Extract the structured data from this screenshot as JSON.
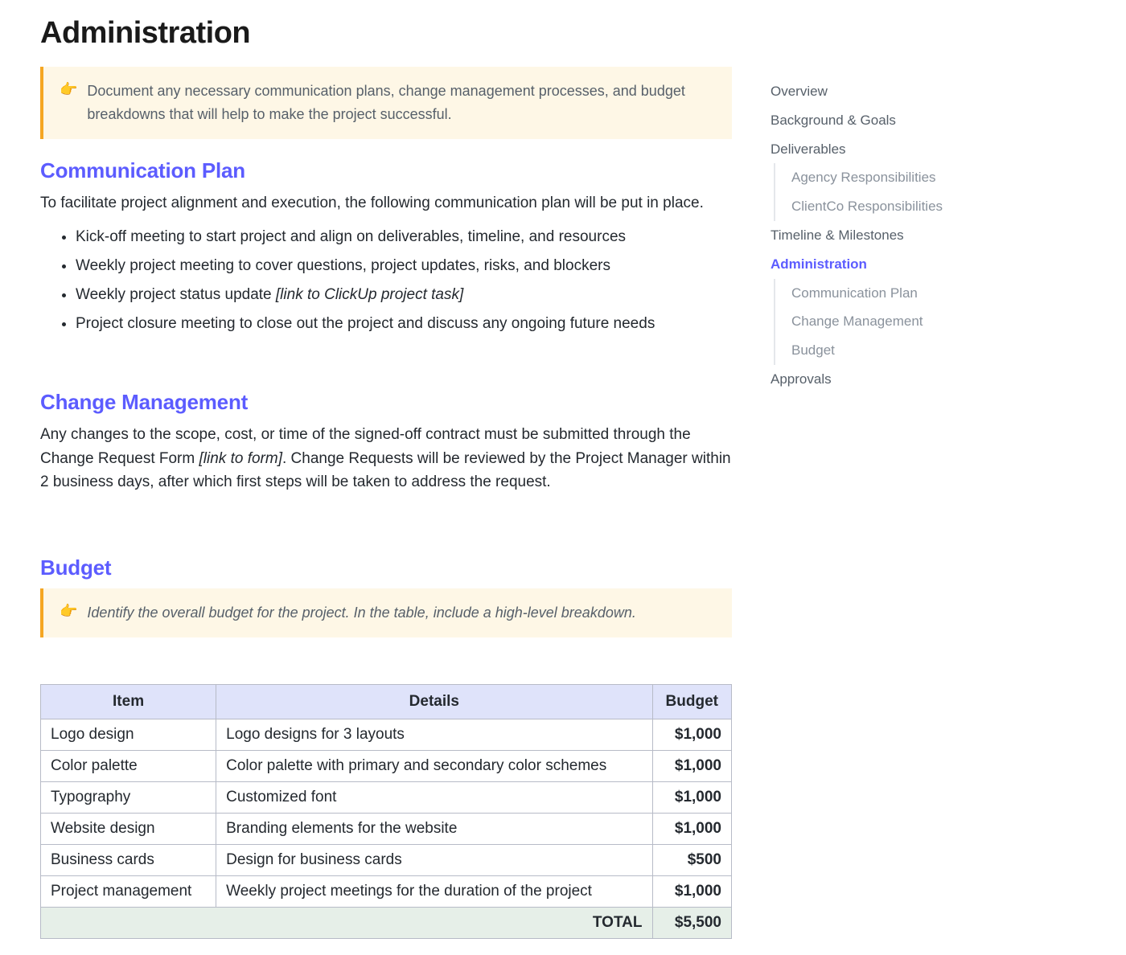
{
  "title": "Administration",
  "callout1": "Document any necessary communication plans, change management processes, and budget breakdowns that will help to make the project successful.",
  "sections": {
    "comm": {
      "heading": "Communication Plan",
      "intro": "To facilitate project alignment and execution, the following communication plan will be put in place.",
      "bullets": [
        {
          "text": "Kick-off meeting to start project and align on deliverables, timeline, and resources",
          "suffix": ""
        },
        {
          "text": "Weekly project meeting to cover questions, project updates, risks, and blockers",
          "suffix": ""
        },
        {
          "text": "Weekly project status update ",
          "suffix": "[link to ClickUp project task]"
        },
        {
          "text": "Project closure meeting to close out the project and discuss any ongoing future needs",
          "suffix": ""
        }
      ]
    },
    "change": {
      "heading": "Change Management",
      "para_pre": "Any changes to the scope, cost, or time of the signed-off contract must be submitted through the Change Request Form ",
      "para_link": "[link to form]",
      "para_post": ". Change Requests will be reviewed by the Project Manager within 2 business days, after which first steps will be taken to address the request."
    },
    "budget": {
      "heading": "Budget",
      "callout": "Identify the overall budget for the project. In the table, include a high-level breakdown.",
      "columns": [
        "Item",
        "Details",
        "Budget"
      ],
      "rows": [
        {
          "item": "Logo design",
          "details": "Logo designs for 3 layouts",
          "amount": "$1,000"
        },
        {
          "item": "Color palette",
          "details": "Color palette with primary and secondary color schemes",
          "amount": "$1,000"
        },
        {
          "item": "Typography",
          "details": "Customized font",
          "amount": "$1,000"
        },
        {
          "item": "Website design",
          "details": "Branding elements for the website",
          "amount": "$1,000"
        },
        {
          "item": "Business cards",
          "details": "Design for business cards",
          "amount": "$500"
        },
        {
          "item": "Project management",
          "details": "Weekly project meetings for the duration of the project",
          "amount": "$1,000"
        }
      ],
      "total_label": "TOTAL",
      "total_amount": "$5,500"
    }
  },
  "nav": [
    {
      "label": "Overview",
      "level": 0,
      "active": false
    },
    {
      "label": "Background & Goals",
      "level": 0,
      "active": false
    },
    {
      "label": "Deliverables",
      "level": 0,
      "active": false
    },
    {
      "label": "Agency Responsibilities",
      "level": 1,
      "active": false
    },
    {
      "label": "ClientCo Responsibilities",
      "level": 1,
      "active": false
    },
    {
      "label": "Timeline & Milestones",
      "level": 0,
      "active": false
    },
    {
      "label": "Administration",
      "level": 0,
      "active": true
    },
    {
      "label": "Communication Plan",
      "level": 1,
      "active": false
    },
    {
      "label": "Change Management",
      "level": 1,
      "active": false
    },
    {
      "label": "Budget",
      "level": 1,
      "active": false
    },
    {
      "label": "Approvals",
      "level": 0,
      "active": false
    }
  ]
}
